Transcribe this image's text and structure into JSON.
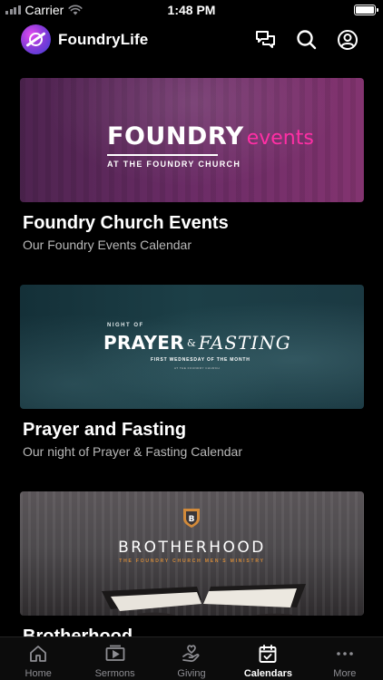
{
  "status_bar": {
    "carrier": "Carrier",
    "time": "1:48 PM"
  },
  "header": {
    "app_title": "FoundryLife",
    "icons": [
      "chat-icon",
      "search-icon",
      "profile-icon"
    ]
  },
  "cards": [
    {
      "title": "Foundry Church Events",
      "subtitle": "Our Foundry Events Calendar",
      "banner": {
        "line1_bold": "FOUNDRY",
        "line1_accent": "events",
        "line2": "AT THE FOUNDRY CHURCH",
        "accent_color": "#ff2fa5"
      }
    },
    {
      "title": "Prayer and Fasting",
      "subtitle": "Our night of Prayer & Fasting Calendar",
      "banner": {
        "top": "NIGHT OF",
        "word1": "PRAYER",
        "amp": "&",
        "word2": "FASTING",
        "sub": "FIRST WEDNESDAY OF THE MONTH",
        "tiny": "AT THE FOUNDRY CHURCH"
      }
    },
    {
      "title": "Brotherhood",
      "subtitle": "",
      "banner": {
        "title": "BROTHERHOOD",
        "sub": "THE FOUNDRY CHURCH MEN'S MINISTRY",
        "accent_color": "#d28a3a"
      }
    }
  ],
  "tabs": [
    {
      "label": "Home",
      "icon": "home-icon",
      "active": false
    },
    {
      "label": "Sermons",
      "icon": "play-icon",
      "active": false
    },
    {
      "label": "Giving",
      "icon": "giving-hand-icon",
      "active": false
    },
    {
      "label": "Calendars",
      "icon": "calendar-icon",
      "active": true
    },
    {
      "label": "More",
      "icon": "more-dots-icon",
      "active": false
    }
  ],
  "colors": {
    "background": "#000000",
    "tab_inactive": "#8e8e93",
    "tab_active": "#ffffff"
  }
}
